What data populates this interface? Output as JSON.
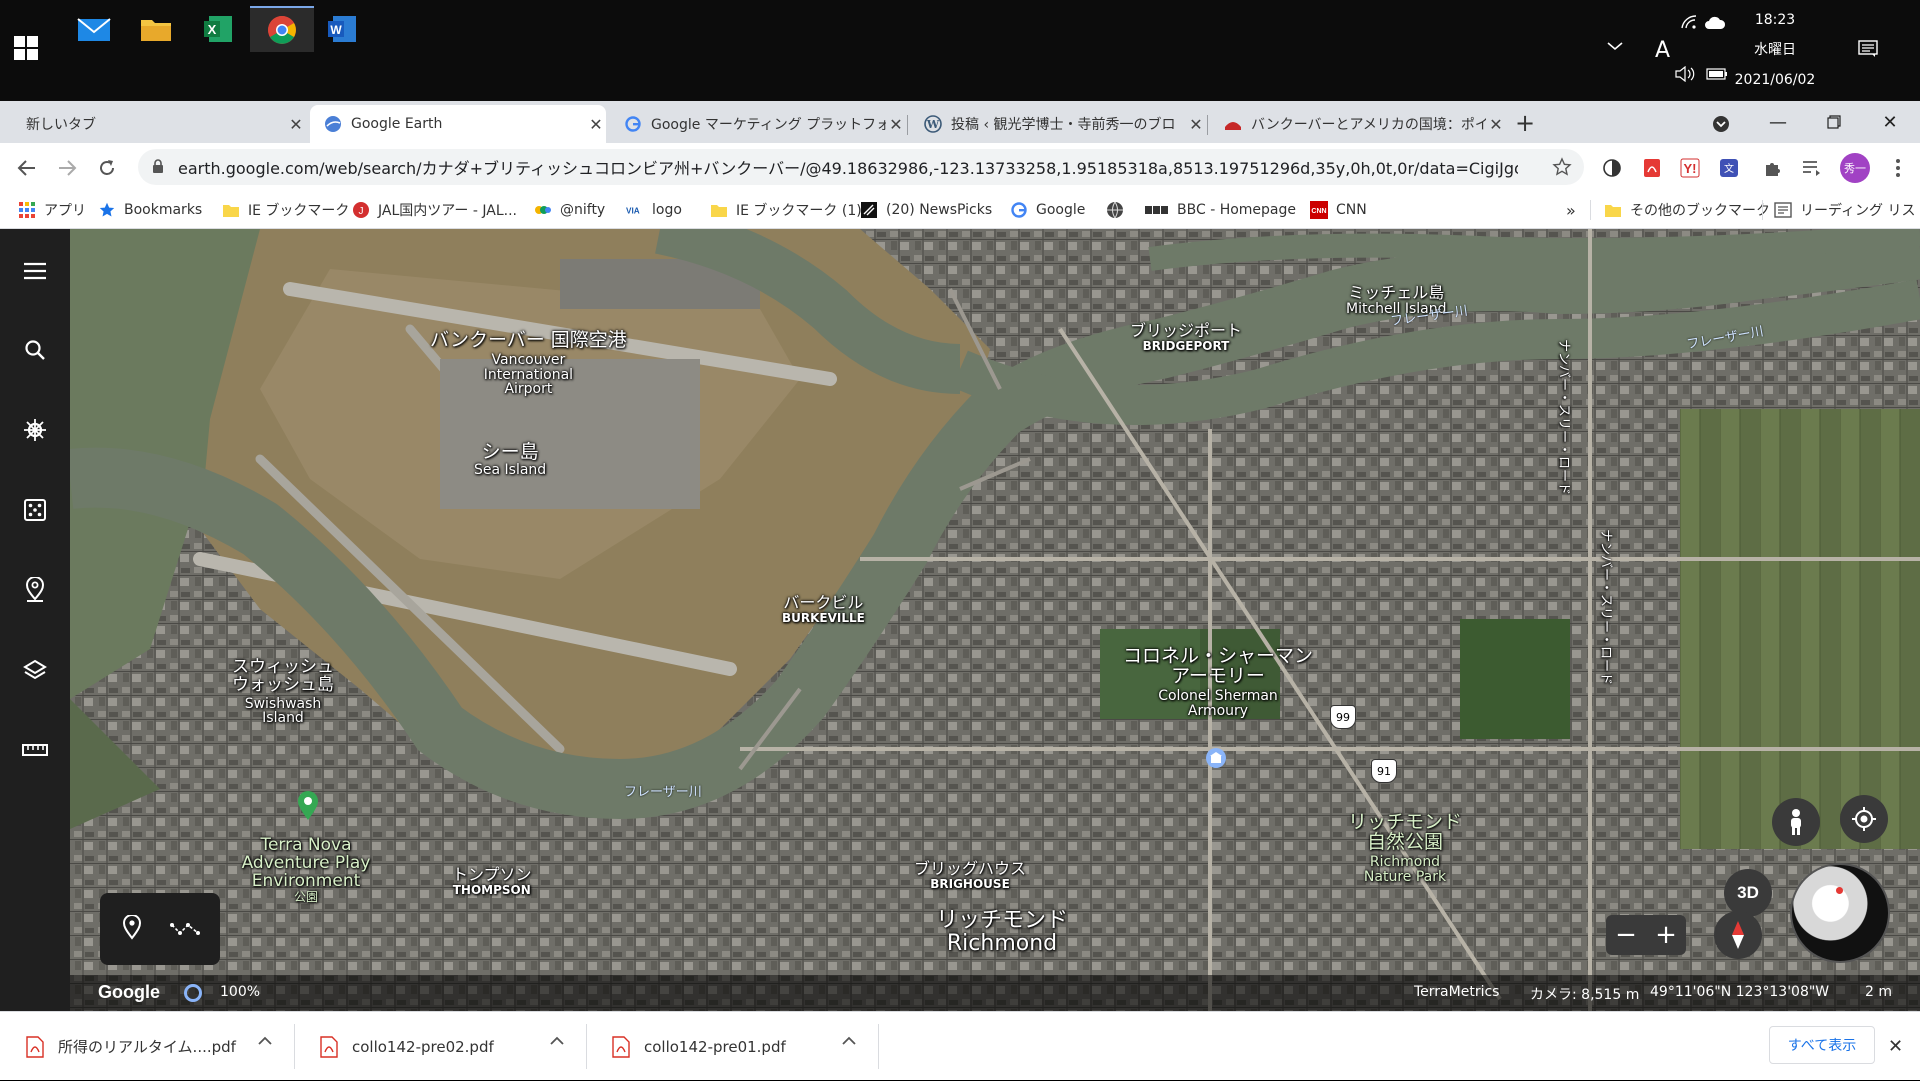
{
  "taskbar": {
    "apps": [
      {
        "name": "mail-app",
        "icon": "mail-icon"
      },
      {
        "name": "file-explorer-app",
        "icon": "folder-icon"
      },
      {
        "name": "excel-app",
        "icon": "excel-icon"
      },
      {
        "name": "chrome-app",
        "icon": "chrome-icon"
      },
      {
        "name": "word-app",
        "icon": "word-icon"
      }
    ],
    "tray": {
      "ime": "A",
      "time": "18:23",
      "day": "水曜日",
      "date": "2021/06/02"
    }
  },
  "tabs": [
    {
      "title": "新しいタブ",
      "icon": "none"
    },
    {
      "title": "Google Earth",
      "icon": "google-earth-icon",
      "active": true
    },
    {
      "title": "Google マーケティング プラットフォーム",
      "icon": "google-icon"
    },
    {
      "title": "投稿 ‹ 観光学博士・寺前秀一のブロ",
      "icon": "wordpress-icon"
    },
    {
      "title": "バンクーバーとアメリカの国境：ポイント",
      "icon": "site-icon"
    }
  ],
  "address": {
    "url": "earth.google.com/web/search/カナダ+ブリティッシュコロンビア州+バンクーバー/@49.18632986,-123.13733258,1.95185318a,8513.19751296d,35y,0h,0t,0r/data=CigiJgokCaxQv4tvgE..."
  },
  "profile": {
    "label": "秀一"
  },
  "bookmarks": [
    {
      "label": "アプリ",
      "icon": "apps-grid-icon"
    },
    {
      "label": "Bookmarks",
      "icon": "star-icon"
    },
    {
      "label": "IE ブックマーク",
      "icon": "folder-icon"
    },
    {
      "label": "JAL国内ツアー - JAL...",
      "icon": "jal-icon"
    },
    {
      "label": "@nifty",
      "icon": "nifty-icon"
    },
    {
      "label": "logo",
      "icon": "via-icon"
    },
    {
      "label": "IE ブックマーク (1)",
      "icon": "folder-icon"
    },
    {
      "label": "(20) NewsPicks",
      "icon": "newspicks-icon"
    },
    {
      "label": "Google",
      "icon": "google-icon"
    },
    {
      "label": "",
      "icon": "globe-icon"
    },
    {
      "label": "BBC - Homepage",
      "icon": "bbc-icon"
    },
    {
      "label": "CNN",
      "icon": "cnn-icon"
    }
  ],
  "bookmarks_overflow": "»",
  "bookmarks_other": "その他のブックマーク",
  "reading_list": "リーディング リスト",
  "earth": {
    "labels": [
      {
        "jp": "バンクーバー 国際空港",
        "en": "Vancouver International Airport"
      },
      {
        "jp": "シー島",
        "en": "Sea Island"
      },
      {
        "jp": "バークビル",
        "en": "BURKEVILLE"
      },
      {
        "jp": "ブリッジポート",
        "en": "BRIDGEPORT"
      },
      {
        "jp": "ミッチェル島",
        "en": "Mitchell Island"
      },
      {
        "jp": "スウィッシュ ウォッシュ島",
        "en": "Swishwash Island"
      },
      {
        "jp": "コロネル・シャーマン アーモリー",
        "en": "Colonel Sherman Armoury"
      },
      {
        "jp": "リッチモンド 自然公園",
        "en": "Richmond Nature Park"
      },
      {
        "jp": "ブリッグハウス",
        "en": "BRIGHOUSE"
      },
      {
        "jp": "トンプソン",
        "en": "THOMPSON"
      },
      {
        "jp": "リッチモンド",
        "en": "Richmond"
      },
      {
        "jp": "Terra Nova Adventure Play Environment",
        "en": "公園"
      }
    ],
    "rivers": [
      "フレーザー川",
      "フレーザー川",
      "フレーザー川"
    ],
    "roads": [
      "ナンバー・スリー・ロード",
      "ナンバー・スリー・ロード"
    ],
    "highways": [
      "99",
      "91"
    ],
    "view_mode": "3D",
    "zoom_out": "−",
    "zoom_in": "+",
    "status": {
      "logo": "Google",
      "load": "100%",
      "attribution": "TerraMetrics",
      "camera": "カメラ: 8,515 m",
      "coords": "49°11'06\"N 123°13'08\"W",
      "scale": "2 m"
    }
  },
  "downloads": [
    {
      "name": "所得のリアルタイム....pdf"
    },
    {
      "name": "collo142-pre02.pdf"
    },
    {
      "name": "collo142-pre01.pdf"
    }
  ],
  "downloads_show_all": "すべて表示",
  "colors": {
    "chrome_tabstrip": "#dee1e6",
    "earth_sidebar": "#1f1f1f",
    "link_blue": "#1a73e8"
  }
}
